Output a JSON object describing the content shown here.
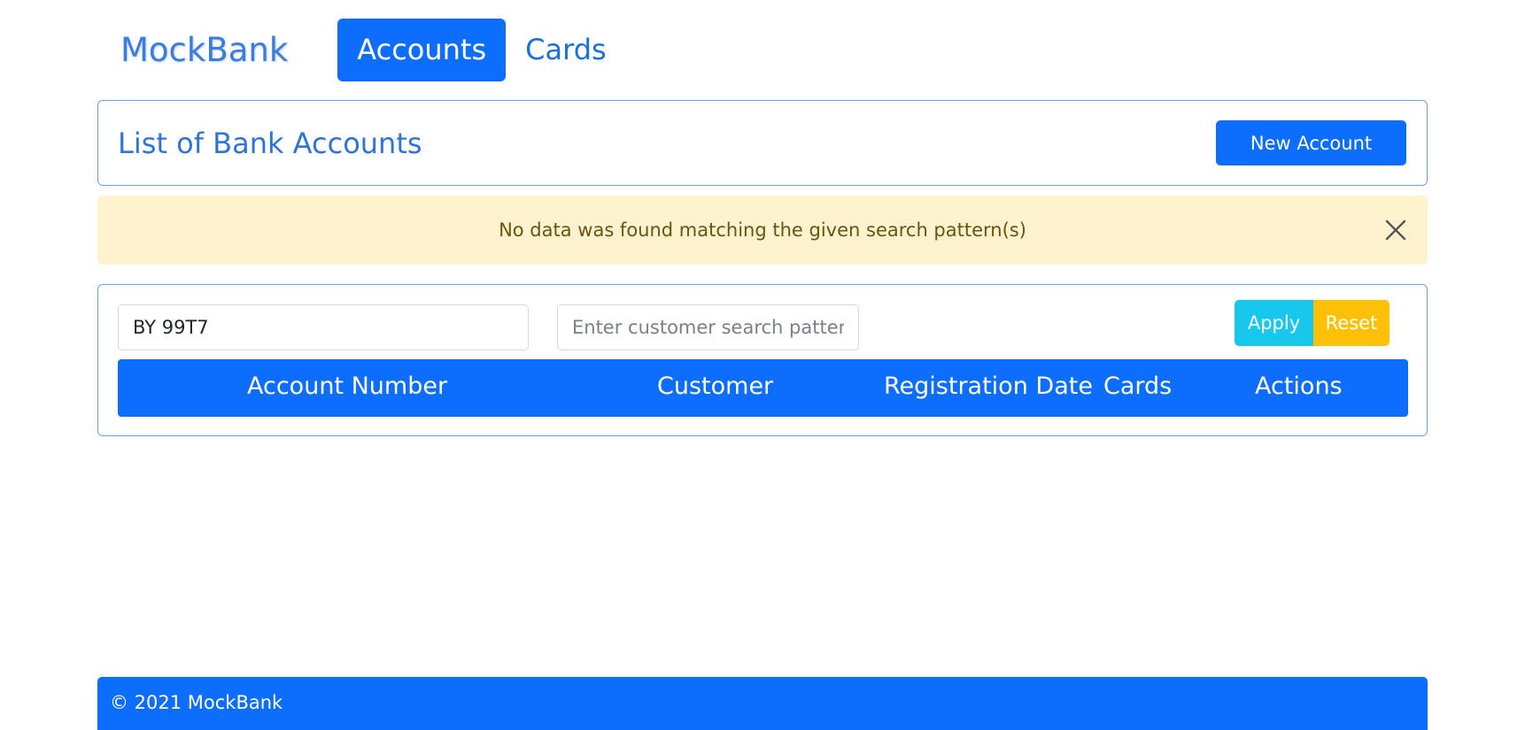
{
  "navbar": {
    "brand": "MockBank",
    "links": [
      {
        "label": "Accounts",
        "active": true
      },
      {
        "label": "Cards",
        "active": false
      }
    ]
  },
  "header": {
    "title": "List of Bank Accounts",
    "new_button_label": "New Account"
  },
  "alert": {
    "message": "No data was found matching the given search pattern(s)",
    "close_icon": "close-icon"
  },
  "filters": {
    "account_value": "BY 99T7",
    "customer_placeholder": "Enter customer search pattern",
    "apply_label": "Apply",
    "reset_label": "Reset"
  },
  "table": {
    "columns": [
      "Account Number",
      "Customer",
      "Registration Date",
      "Cards",
      "Actions"
    ],
    "rows": []
  },
  "footer": {
    "text": "© 2021 MockBank"
  },
  "colors": {
    "primary": "#0d6efd",
    "info": "#17c8ec",
    "warning": "#ffc107",
    "alert_bg": "#fff2cf"
  }
}
